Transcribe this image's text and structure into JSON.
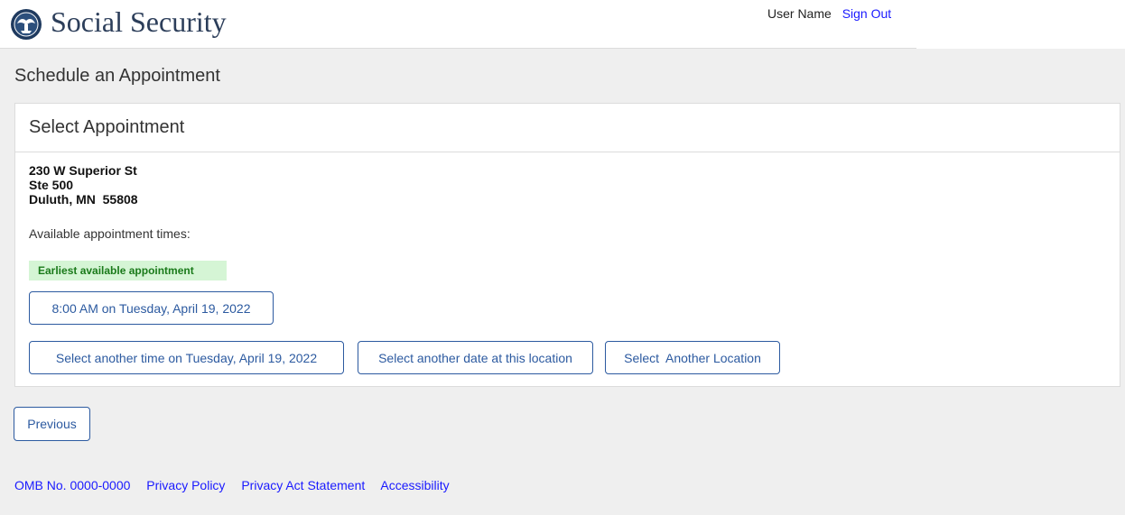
{
  "header": {
    "brand": "Social Security",
    "user_name": "User Name",
    "sign_out": "Sign Out",
    "logo_icon": "ssa-seal-icon"
  },
  "page": {
    "title": "Schedule an Appointment"
  },
  "panel": {
    "heading": "Select Appointment",
    "address": {
      "line1": "230 W Superior St",
      "line2": "Ste 500",
      "line3": "Duluth, MN  55808"
    },
    "available_label": "Available appointment times:",
    "earliest_badge": "Earliest available appointment",
    "earliest_button": "8:00 AM on Tuesday, April 19, 2022",
    "actions": {
      "another_time": "Select another time on Tuesday, April 19, 2022",
      "another_date": "Select another date at this location",
      "another_location": "Select  Another Location"
    }
  },
  "nav": {
    "previous": "Previous"
  },
  "footer": {
    "omb": "OMB No. 0000-0000",
    "privacy_policy": "Privacy Policy",
    "privacy_act": "Privacy Act Statement",
    "accessibility": "Accessibility"
  },
  "colors": {
    "page_bg": "#efefef",
    "brand_text": "#2c3e5a",
    "link": "#1a1aff",
    "button_border": "#2c5aa0",
    "badge_bg": "#d5f5d5",
    "badge_text": "#1a7a1a"
  }
}
